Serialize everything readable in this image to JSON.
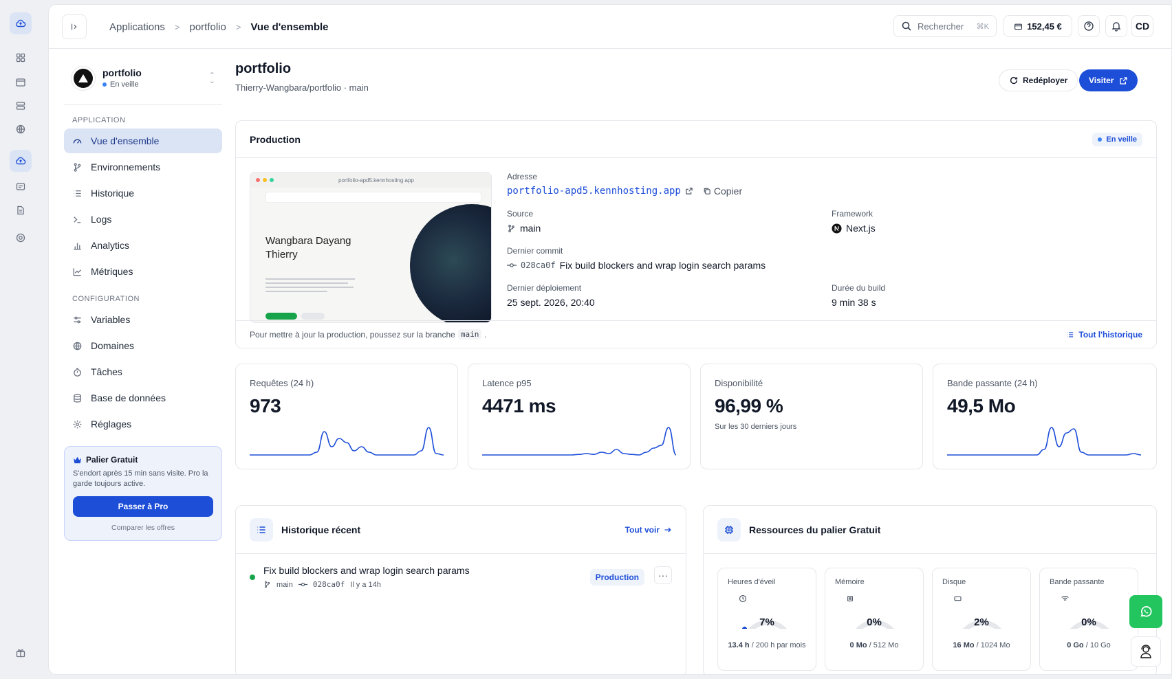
{
  "breadcrumb": {
    "root": "Applications",
    "project": "portfolio",
    "current": "Vue d'ensemble"
  },
  "topbar": {
    "search_label": "Rechercher",
    "search_shortcut": "⌘K",
    "credits": "152,45 €",
    "avatar_initials": "CD"
  },
  "project": {
    "name": "portfolio",
    "status": "En veille"
  },
  "sidebar": {
    "application_label": "APPLICATION",
    "application_items": [
      {
        "label": "Vue d'ensemble",
        "icon": "gauge-icon",
        "active": true
      },
      {
        "label": "Environnements",
        "icon": "git-branch-icon"
      },
      {
        "label": "Historique",
        "icon": "list-icon"
      },
      {
        "label": "Logs",
        "icon": "terminal-icon"
      },
      {
        "label": "Analytics",
        "icon": "bar-chart-icon"
      },
      {
        "label": "Métriques",
        "icon": "line-chart-icon"
      }
    ],
    "configuration_label": "CONFIGURATION",
    "configuration_items": [
      {
        "label": "Variables",
        "icon": "sliders-icon"
      },
      {
        "label": "Domaines",
        "icon": "globe-icon"
      },
      {
        "label": "Tâches",
        "icon": "timer-icon"
      },
      {
        "label": "Base de données",
        "icon": "database-icon"
      },
      {
        "label": "Réglages",
        "icon": "gear-icon"
      }
    ],
    "tier": {
      "title": "Palier Gratuit",
      "description": "S'endort après 15 min sans visite. Pro la garde toujours active.",
      "cta": "Passer à Pro",
      "compare": "Comparer les offres"
    }
  },
  "header": {
    "title": "portfolio",
    "repo": "Thierry-Wangbara/portfolio · main",
    "redeploy": "Redéployer",
    "visit": "Visiter"
  },
  "production": {
    "title": "Production",
    "status": "En veille",
    "preview": {
      "url": "portfolio-apd5.kennhosting.app",
      "heading_line1": "Wangbara Dayang",
      "heading_line2": "Thierry"
    },
    "address_label": "Adresse",
    "address": "portfolio-apd5.kennhosting.app",
    "copy_label": "Copier",
    "source_label": "Source",
    "source": "main",
    "framework_label": "Framework",
    "framework": "Next.js",
    "commit_label": "Dernier commit",
    "commit_hash": "028ca0f",
    "commit_message": "Fix build blockers and wrap login search params",
    "deploy_label": "Dernier déploiement",
    "deploy_date": "25 sept. 2026, 20:40",
    "build_label": "Durée du build",
    "build_duration": "9 min 38 s",
    "footer_text_before": "Pour mettre à jour la production, poussez sur la branche",
    "footer_branch": "main",
    "footer_text_after": ".",
    "history_link": "Tout l'historique"
  },
  "metrics": [
    {
      "label": "Requêtes (24 h)",
      "value": "973",
      "sub": ""
    },
    {
      "label": "Latence p95",
      "value": "4471 ms",
      "sub": ""
    },
    {
      "label": "Disponibilité",
      "value": "96,99 %",
      "sub": "Sur les 30 derniers jours"
    },
    {
      "label": "Bande passante (24 h)",
      "value": "49,5 Mo",
      "sub": ""
    }
  ],
  "sparklines": [
    [
      0,
      0,
      0,
      0,
      0,
      0,
      0,
      0,
      0,
      0.1,
      0.85,
      0.3,
      0.6,
      0.45,
      0.15,
      0.3,
      0.1,
      0,
      0,
      0,
      0,
      0,
      0,
      0.15,
      1,
      0.05,
      0
    ],
    [
      0,
      0,
      0,
      0,
      0,
      0,
      0,
      0,
      0,
      0,
      0,
      0,
      0,
      0.02,
      0.05,
      0.02,
      0.1,
      0.05,
      0.2,
      0.05,
      0.02,
      0,
      0.1,
      0.25,
      0.35,
      1,
      0
    ],
    [],
    [
      0,
      0,
      0,
      0,
      0,
      0,
      0,
      0,
      0,
      0,
      0,
      0,
      0,
      0.2,
      1,
      0.3,
      0.8,
      0.95,
      0.1,
      0,
      0,
      0,
      0,
      0,
      0,
      0.05,
      0
    ]
  ],
  "history": {
    "title": "Historique récent",
    "see_all": "Tout voir",
    "items": [
      {
        "title": "Fix build blockers and wrap login search params",
        "branch": "main",
        "hash": "028ca0f",
        "time": "Il y a 14h",
        "env": "Production"
      }
    ]
  },
  "resources": {
    "title": "Ressources du palier Gratuit",
    "items": [
      {
        "label": "Heures d'éveil",
        "icon": "clock-icon",
        "percent": 7,
        "percent_label": "7%",
        "used": "13.4 h",
        "limit": "/ 200 h par mois"
      },
      {
        "label": "Mémoire",
        "icon": "chip-icon",
        "percent": 0,
        "percent_label": "0%",
        "used": "0 Mo",
        "limit": "/ 512 Mo"
      },
      {
        "label": "Disque",
        "icon": "hard-drive-icon",
        "percent": 2,
        "percent_label": "2%",
        "used": "16 Mo",
        "limit": "/ 1024 Mo"
      },
      {
        "label": "Bande passante",
        "icon": "wifi-icon",
        "percent": 0,
        "percent_label": "0%",
        "used": "0 Go",
        "limit": "/ 10 Go"
      }
    ]
  },
  "colors": {
    "accent": "#1d4ed8",
    "active_bg": "#dbe4f5",
    "success": "#16a34a",
    "whatsapp": "#22c55e"
  }
}
